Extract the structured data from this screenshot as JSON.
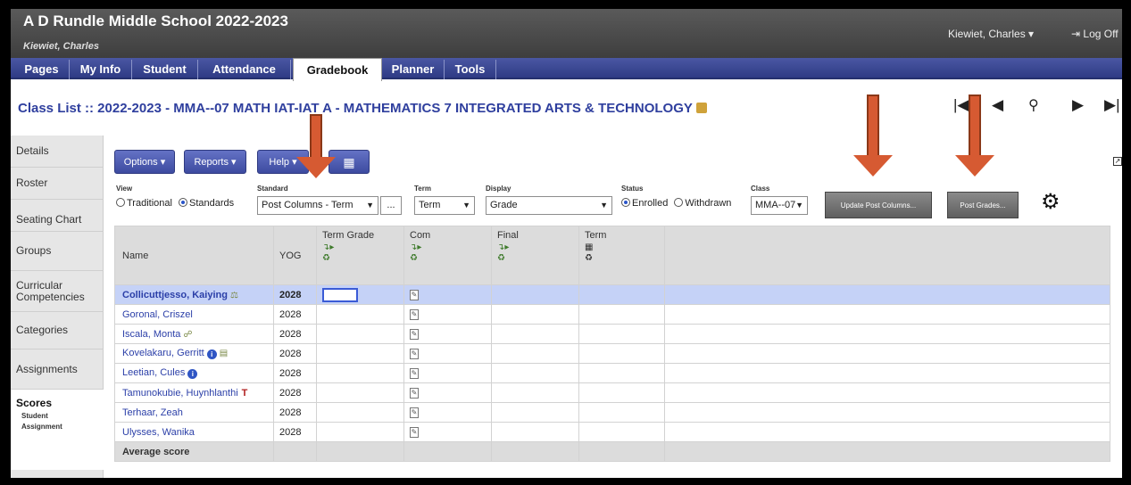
{
  "header": {
    "school": "A D Rundle Middle School 2022-2023",
    "user_sub": "Kiewiet, Charles",
    "user_menu": "Kiewiet, Charles ▾",
    "logoff": "⇥ Log Off"
  },
  "nav": {
    "tabs": [
      {
        "label": "Pages"
      },
      {
        "label": "My Info"
      },
      {
        "label": "Student"
      },
      {
        "label": "Attendance"
      },
      {
        "label": "Gradebook"
      },
      {
        "label": "Planner"
      },
      {
        "label": "Tools"
      }
    ],
    "active": "Gradebook"
  },
  "page_title": "Class List :: 2022-2023 - MMA--07 MATH IAT-IAT A - MATHEMATICS 7 INTEGRATED ARTS & TECHNOLOGY",
  "record_nav": {
    "first": "|◀",
    "prev": "◀",
    "search": "🔍",
    "next": "▶",
    "last": "▶|"
  },
  "side": {
    "items": [
      "Details",
      "Roster",
      "Seating Chart",
      "Groups",
      "Curricular Competencies",
      "Categories",
      "Assignments"
    ],
    "active": "Scores",
    "sub_items": [
      "Student",
      "Assignment"
    ]
  },
  "toolbar": {
    "options": "Options ▾",
    "reports": "Reports ▾",
    "help": "Help ▾",
    "view_label": "View",
    "view_traditional": "Traditional",
    "view_standards": "Standards",
    "standard_label": "Standard",
    "standard_value": "Post Columns - Term",
    "standard_more": "...",
    "term_label": "Term",
    "term_value": "Term",
    "display_label": "Display",
    "display_value": "Grade",
    "status_label": "Status",
    "status_enrolled": "Enrolled",
    "status_withdrawn": "Withdrawn",
    "class_label": "Class",
    "class_value": "MMA--07",
    "update_post": "Update Post Columns...",
    "post_grades": "Post Grades..."
  },
  "table": {
    "headers": {
      "name": "Name",
      "yog": "YOG",
      "term_grade": "Term Grade",
      "com": "Com",
      "final": "Final",
      "term": "Term"
    },
    "rows": [
      {
        "name": "Collicuttjesso, Kaiying",
        "yog": "2028",
        "icon": "scale-icon"
      },
      {
        "name": "Goronal, Criszel",
        "yog": "2028",
        "icon": ""
      },
      {
        "name": "Iscala, Monta",
        "yog": "2028",
        "icon": "link-icon"
      },
      {
        "name": "Kovelakaru, Gerritt",
        "yog": "2028",
        "icon": "info-icon"
      },
      {
        "name": "Leetian, Cules",
        "yog": "2028",
        "icon": "info-icon"
      },
      {
        "name": "Tamunokubie, Huynhlanthi",
        "yog": "2028",
        "icon": "flag-icon"
      },
      {
        "name": "Terhaar, Zeah",
        "yog": "2028",
        "icon": ""
      },
      {
        "name": "Ulysses, Wanika",
        "yog": "2028",
        "icon": ""
      }
    ],
    "average_label": "Average score"
  },
  "colors": {
    "nav": "#3a469a",
    "title": "#2f3f9e",
    "arrow": "#d65a32",
    "selected_row": "#c5d2f7"
  }
}
